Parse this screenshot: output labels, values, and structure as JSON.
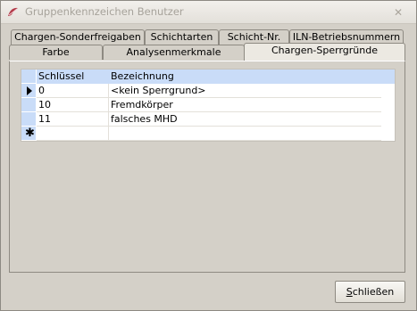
{
  "window": {
    "title": "Gruppenkennzeichen Benutzer",
    "close_glyph": "✕",
    "app_icon": "app-logo-icon"
  },
  "tabs_back": [
    "Chargen-Sonderfreigaben",
    "Schichtarten",
    "Schicht-Nr.",
    "ILN-Betriebsnummern"
  ],
  "tabs_front": [
    "Farbe",
    "Analysenmerkmale",
    "Chargen-Sperrgründe"
  ],
  "active_tab": "Chargen-Sperrgründe",
  "grid": {
    "columns": [
      "Schlüssel",
      "Bezeichnung"
    ],
    "rows": [
      {
        "key": "0",
        "desc": "<kein Sperrgrund>"
      },
      {
        "key": "10",
        "desc": "Fremdkörper"
      },
      {
        "key": "11",
        "desc": "falsches MHD"
      }
    ],
    "current_row_icon": "row-pointer-icon",
    "new_row_glyph": "✱"
  },
  "footer": {
    "close_button_label_mnemonic": "S",
    "close_button_label_rest": "chließen"
  },
  "colors": {
    "grid_header": "#c9dcf8",
    "dialog_bg": "#d4d0c8"
  }
}
